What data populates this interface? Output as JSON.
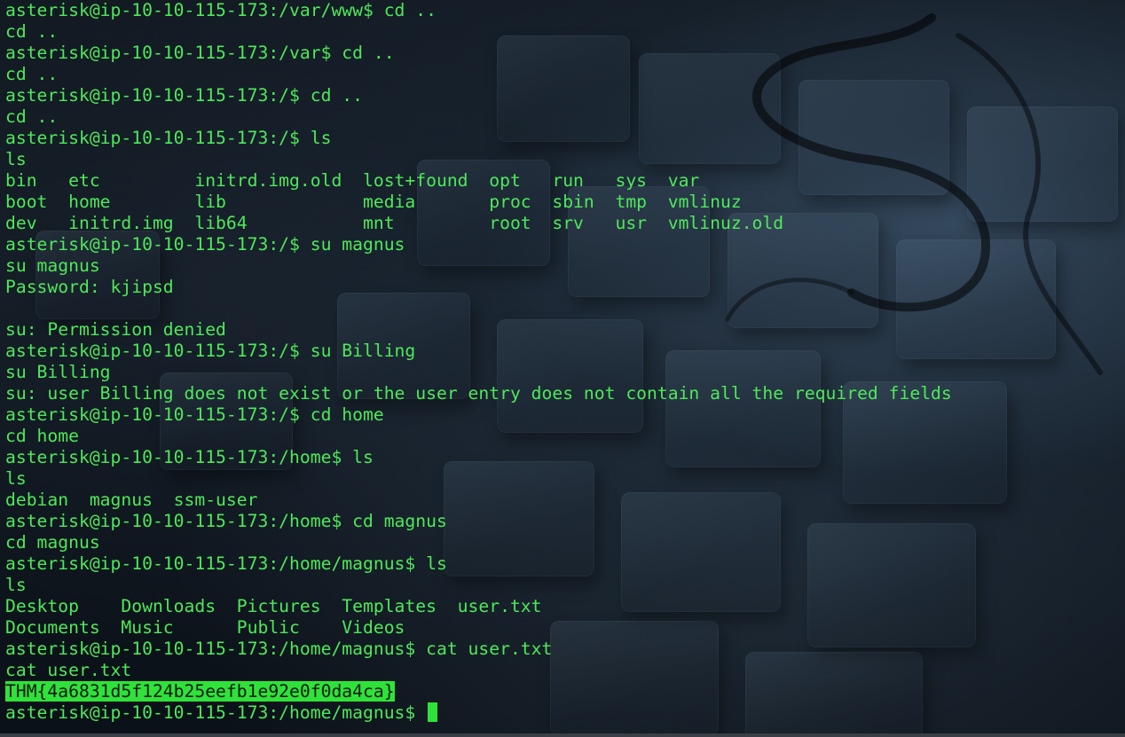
{
  "terminal": {
    "lines": [
      "asterisk@ip-10-10-115-173:/var/www$ cd ..",
      "cd ..",
      "asterisk@ip-10-10-115-173:/var$ cd ..",
      "cd ..",
      "asterisk@ip-10-10-115-173:/$ cd ..",
      "cd ..",
      "asterisk@ip-10-10-115-173:/$ ls",
      "ls",
      "bin   etc         initrd.img.old  lost+found  opt   run   sys  var",
      "boot  home        lib             media       proc  sbin  tmp  vmlinuz",
      "dev   initrd.img  lib64           mnt         root  srv   usr  vmlinuz.old",
      "asterisk@ip-10-10-115-173:/$ su magnus",
      "su magnus",
      "Password: kjipsd",
      "",
      "su: Permission denied",
      "asterisk@ip-10-10-115-173:/$ su Billing",
      "su Billing",
      "su: user Billing does not exist or the user entry does not contain all the required fields",
      "asterisk@ip-10-10-115-173:/$ cd home",
      "cd home",
      "asterisk@ip-10-10-115-173:/home$ ls",
      "ls",
      "debian  magnus  ssm-user",
      "asterisk@ip-10-10-115-173:/home$ cd magnus",
      "cd magnus",
      "asterisk@ip-10-10-115-173:/home/magnus$ ls",
      "ls",
      "Desktop    Downloads  Pictures  Templates  user.txt",
      "Documents  Music      Public    Videos",
      "asterisk@ip-10-10-115-173:/home/magnus$ cat user.txt",
      "cat user.txt"
    ],
    "flag": "THM{4a6831d5f124b25eefb1e92e0f0da4ca}",
    "prompt": "asterisk@ip-10-10-115-173:/home/magnus$ "
  },
  "colors": {
    "text": "#4ee85a",
    "highlight": "#2fe23a",
    "background": "#0d141c"
  }
}
